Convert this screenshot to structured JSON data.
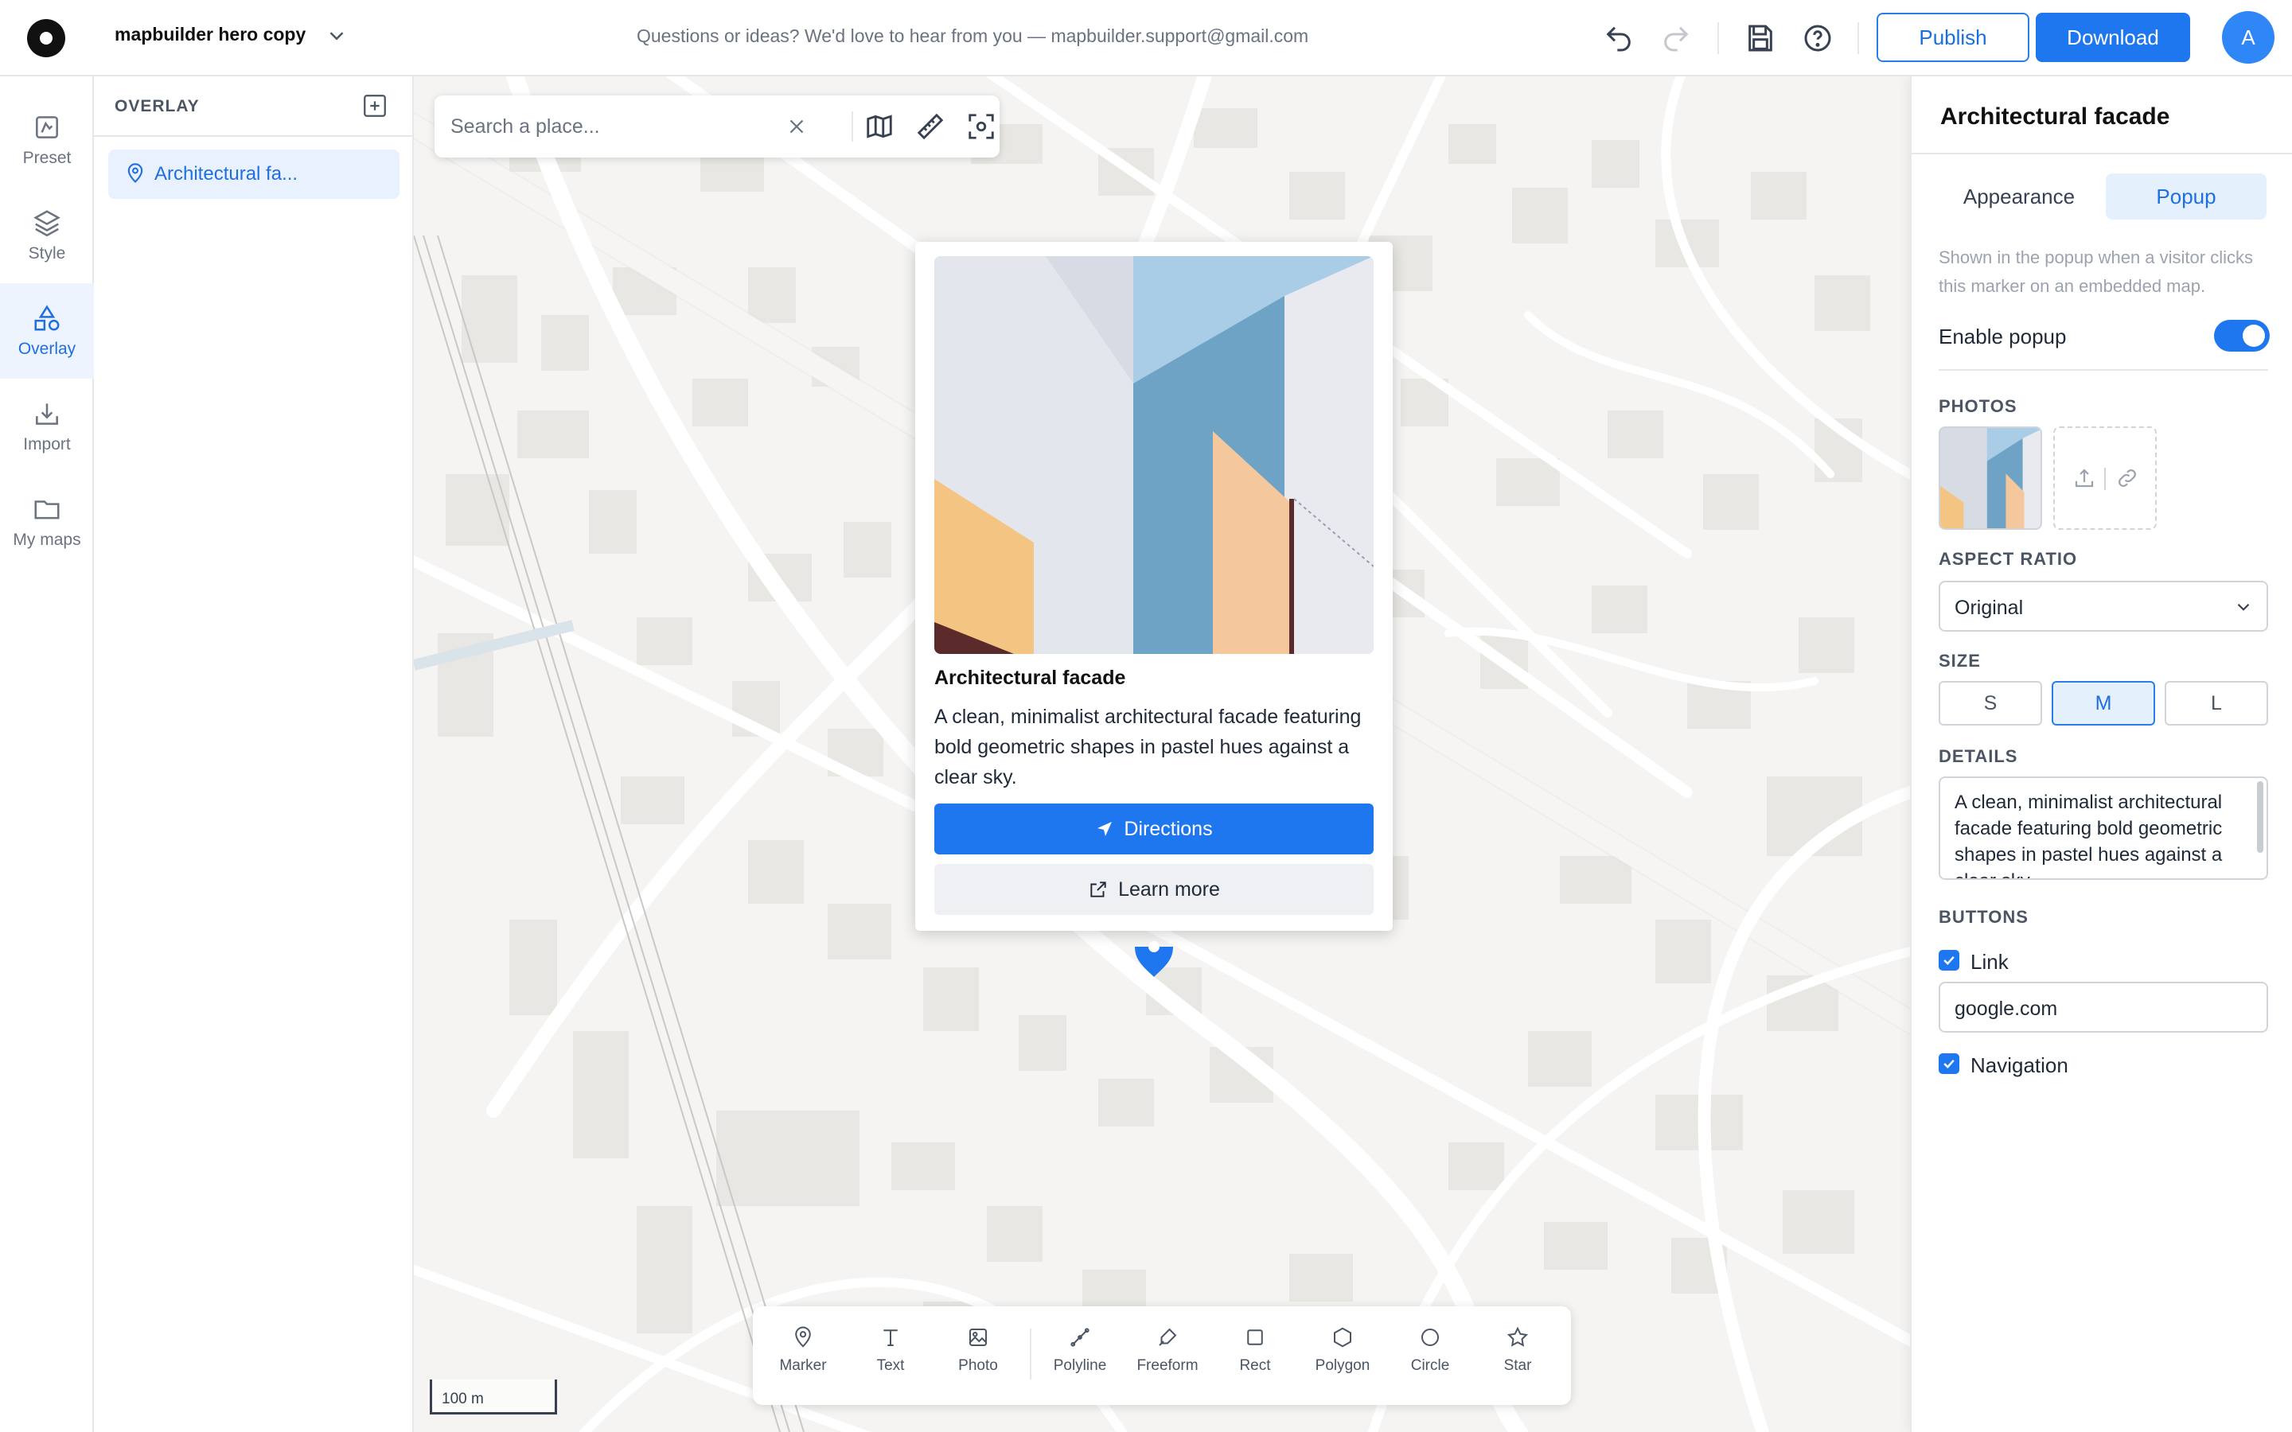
{
  "header": {
    "project_name": "mapbuilder hero copy",
    "feedback_text": "Questions or ideas? We'd love to hear from you — mapbuilder.support@gmail.com",
    "publish_label": "Publish",
    "download_label": "Download",
    "avatar_initial": "A"
  },
  "rail": {
    "items": [
      {
        "label": "Preset",
        "icon": "preset-icon"
      },
      {
        "label": "Style",
        "icon": "layers-icon"
      },
      {
        "label": "Overlay",
        "icon": "shapes-icon",
        "active": true
      },
      {
        "label": "Import",
        "icon": "import-icon"
      },
      {
        "label": "My maps",
        "icon": "folder-icon"
      }
    ]
  },
  "panel": {
    "title": "OVERLAY",
    "items": [
      {
        "label": "Architectural fa...",
        "icon": "pin-icon",
        "selected": true
      }
    ]
  },
  "search": {
    "placeholder": "Search a place..."
  },
  "popup": {
    "title": "Architectural facade",
    "description": "A clean, minimalist architectural facade featuring bold geometric shapes in pastel hues against a clear sky.",
    "directions_label": "Directions",
    "learn_more_label": "Learn more"
  },
  "tools": {
    "items": [
      {
        "label": "Marker",
        "icon": "marker-icon"
      },
      {
        "label": "Text",
        "icon": "text-icon"
      },
      {
        "label": "Photo",
        "icon": "photo-icon"
      },
      {
        "label": "Polyline",
        "icon": "polyline-icon"
      },
      {
        "label": "Freeform",
        "icon": "freeform-icon"
      },
      {
        "label": "Rect",
        "icon": "rect-icon"
      },
      {
        "label": "Polygon",
        "icon": "polygon-icon"
      },
      {
        "label": "Circle",
        "icon": "circle-icon"
      },
      {
        "label": "Star",
        "icon": "star-icon"
      }
    ]
  },
  "scale": {
    "label": "100 m"
  },
  "inspector": {
    "title": "Architectural facade",
    "tabs": [
      {
        "label": "Appearance"
      },
      {
        "label": "Popup",
        "active": true
      }
    ],
    "help_text": "Shown in the popup when a visitor clicks this marker on an embedded map.",
    "enable_popup_label": "Enable popup",
    "enable_popup": true,
    "photos_label": "PHOTOS",
    "aspect_label": "ASPECT RATIO",
    "aspect_value": "Original",
    "size_label": "SIZE",
    "sizes": [
      {
        "label": "S"
      },
      {
        "label": "M",
        "active": true
      },
      {
        "label": "L"
      }
    ],
    "details_label": "DETAILS",
    "details_value": "A clean, minimalist architectural facade featuring bold geometric shapes in pastel hues against a clear sky.",
    "buttons_label": "BUTTONS",
    "link_label": "Link",
    "link_checked": true,
    "link_value": "google.com",
    "navigation_label": "Navigation",
    "navigation_checked": true
  },
  "colors": {
    "accent": "#1f77f0",
    "accent_light": "#e5f0fd",
    "map_bg": "#f5f4f2",
    "building": "#e8e7e3",
    "road": "#ffffff"
  }
}
